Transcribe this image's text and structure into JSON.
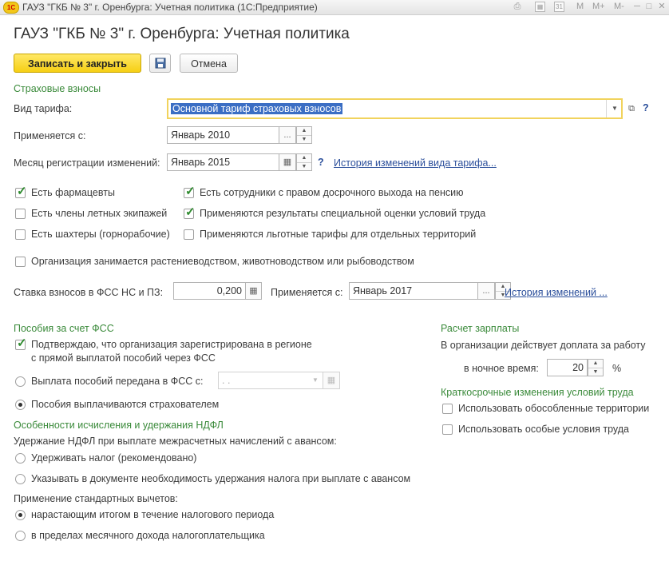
{
  "window": {
    "title": "ГАУЗ \"ГКБ № 3\" г. Оренбурга: Учетная политика  (1С:Предприятие)",
    "logo_text": "1С",
    "icons": [
      "printer-icon",
      "calculator-icon",
      "calendar-icon",
      "M",
      "M+",
      "M-",
      "minimize-icon",
      "maximize-icon",
      "close-icon"
    ],
    "m_labels": [
      "M",
      "M+",
      "M-"
    ],
    "calendar_day": "31"
  },
  "page": {
    "title": "ГАУЗ \"ГКБ № 3\" г. Оренбурга: Учетная политика"
  },
  "toolbar": {
    "save_close_label": "Записать и закрыть",
    "cancel_label": "Отмена"
  },
  "insurance": {
    "section_title": "Страховые взносы",
    "tariff_label": "Вид тарифа:",
    "tariff_value": "Основной тариф страховых взносов",
    "applies_label": "Применяется с:",
    "applies_value": "Январь 2010",
    "reg_month_label": "Месяц регистрации изменений:",
    "reg_month_value": "Январь 2015",
    "help": "?",
    "history_link": "История изменений вида тарифа...",
    "checkboxes": [
      {
        "label": "Есть фармацевты",
        "checked": true
      },
      {
        "label": "Есть члены летных экипажей",
        "checked": false
      },
      {
        "label": "Есть шахтеры (горнорабочие)",
        "checked": false
      },
      {
        "label": "Есть сотрудники с правом досрочного выхода на пенсию",
        "checked": true
      },
      {
        "label": "Применяются результаты специальной оценки условий труда",
        "checked": true
      },
      {
        "label": "Применяются льготные тарифы для отдельных территорий",
        "checked": false
      },
      {
        "label": "Организация занимается растениеводством, животноводством или рыбоводством",
        "checked": false
      }
    ],
    "fss_rate_label": "Ставка взносов в ФСС НС и ПЗ:",
    "fss_rate_value": "0,200",
    "fss_applies_label": "Применяется с:",
    "fss_applies_value": "Январь 2017",
    "fss_history_link": "История изменений ..."
  },
  "benefits": {
    "section_title": "Пособия за счет ФСС",
    "confirm_label_line1": "Подтверждаю, что организация зарегистрирована в регионе",
    "confirm_label_line2": "с прямой выплатой пособий через ФСС",
    "confirm_checked": true,
    "radio_transferred_label": "Выплата пособий передана в ФСС с:",
    "transferred_date": " .  .",
    "radio_insurer_label": "Пособия выплачиваются страхователем",
    "selected": "insurer"
  },
  "ndfl": {
    "section_title": "Особенности исчисления и удержания НДФЛ",
    "withholding_label": "Удержание НДФЛ при выплате межрасчетных начислений с авансом:",
    "withholding_options": [
      {
        "label": "Удерживать налог (рекомендовано)",
        "selected": false
      },
      {
        "label": "Указывать в документе необходимость удержания налога при выплате с авансом",
        "selected": false
      }
    ],
    "deductions_label": "Применение стандартных вычетов:",
    "deductions_options": [
      {
        "label": "нарастающим итогом в течение налогового периода",
        "selected": true
      },
      {
        "label": "в пределах месячного дохода налогоплательщика",
        "selected": false
      }
    ]
  },
  "salary": {
    "section_title": "Расчет зарплаты",
    "night_label_line1": "В организации действует доплата за работу",
    "night_label_line2": "в ночное время:",
    "night_value": "20",
    "percent": "%"
  },
  "shortterm": {
    "section_title": "Краткосрочные изменения условий труда",
    "options": [
      {
        "label": "Использовать обособленные территории",
        "checked": false
      },
      {
        "label": "Использовать особые условия труда",
        "checked": false
      }
    ]
  },
  "colors": {
    "section": "#3a8a3a",
    "link": "#2b4f9b",
    "primary_button": "#f6cf14",
    "focus_border": "#f1d35d",
    "selection": "#3b6ec4"
  }
}
